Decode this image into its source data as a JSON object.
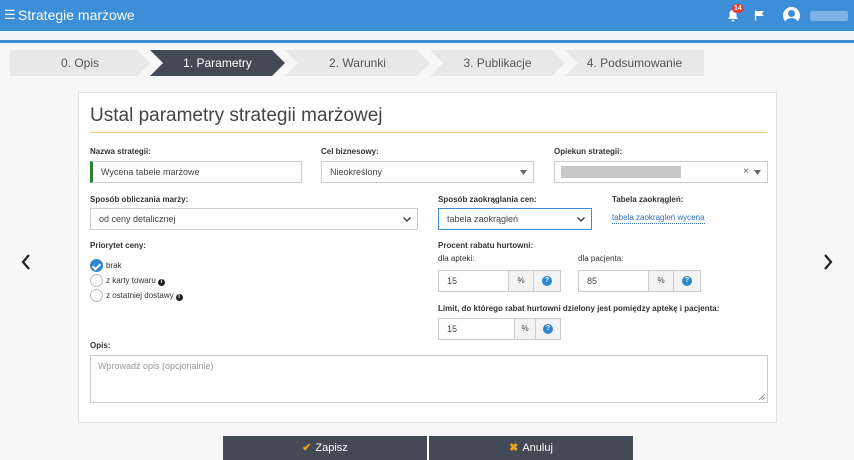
{
  "topbar": {
    "app_title": "Strategie marżowe",
    "notification_count": "14"
  },
  "steps": [
    {
      "label": "0. Opis",
      "active": false
    },
    {
      "label": "1. Parametry",
      "active": true
    },
    {
      "label": "2. Warunki",
      "active": false
    },
    {
      "label": "3. Publikacje",
      "active": false
    },
    {
      "label": "4. Podsumowanie",
      "active": false
    }
  ],
  "form": {
    "title": "Ustal parametry strategii marżowej",
    "strategy_name": {
      "label": "Nazwa strategii:",
      "value": "Wycena tabele marżowe"
    },
    "business_goal": {
      "label": "Cel biznesowy:",
      "value": "Nieokreślony"
    },
    "strategy_owner": {
      "label": "Opiekun strategii:",
      "clear": "×"
    },
    "margin_method": {
      "label": "Sposób obliczania marży:",
      "value": "od ceny detalicznej"
    },
    "rounding_method": {
      "label": "Sposób zaokrąglania cen:",
      "value": "tabela zaokrągleń"
    },
    "rounding_table": {
      "label": "Tabela zaokrągleń:",
      "link": "tabela zaokrągleń wycena"
    },
    "price_priority": {
      "label": "Priorytet ceny:",
      "options": [
        {
          "label": "brak",
          "checked": true,
          "info": false
        },
        {
          "label": "z karty towaru",
          "checked": false,
          "info": true
        },
        {
          "label": "z ostatniej dostawy",
          "checked": false,
          "info": true
        }
      ],
      "info_glyph": "i"
    },
    "wholesale_discount": {
      "label": "Procent rabatu hurtowni:",
      "pharmacy_label": "dla apteki:",
      "pharmacy_value": "15",
      "patient_label": "dla pacjenta:",
      "patient_value": "85",
      "unit": "%",
      "help_glyph": "?"
    },
    "discount_limit": {
      "label": "Limit, do którego rabat hurtowni dzielony jest pomiędzy aptekę i pacjenta:",
      "value": "15",
      "unit": "%"
    },
    "description": {
      "label": "Opis:",
      "placeholder": "Wprowadź opis (opcjonalnie)"
    }
  },
  "footer": {
    "save_label": "Zapisz",
    "cancel_label": "Anuluj",
    "save_icon": "check-icon",
    "cancel_icon": "x-icon"
  },
  "colors": {
    "topbar": "#3c8ed6",
    "active_step": "#434a55",
    "accent_line": "#f0c38a",
    "required_marker": "#2e7d32",
    "help_icon": "#2f86d1"
  }
}
